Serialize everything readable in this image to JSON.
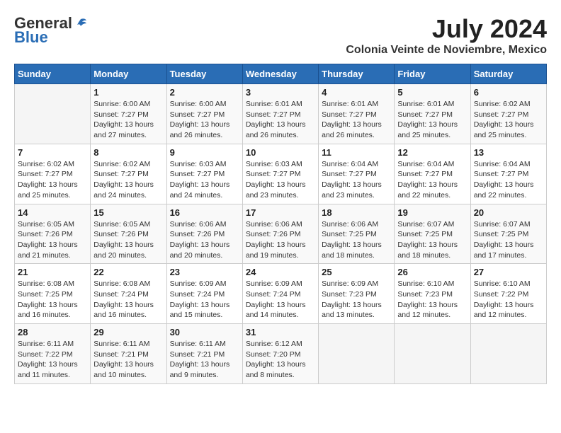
{
  "header": {
    "logo_line1": "General",
    "logo_line2": "Blue",
    "month_year": "July 2024",
    "location": "Colonia Veinte de Noviembre, Mexico"
  },
  "days_of_week": [
    "Sunday",
    "Monday",
    "Tuesday",
    "Wednesday",
    "Thursday",
    "Friday",
    "Saturday"
  ],
  "weeks": [
    [
      {
        "num": "",
        "sunrise": "",
        "sunset": "",
        "daylight": ""
      },
      {
        "num": "1",
        "sunrise": "Sunrise: 6:00 AM",
        "sunset": "Sunset: 7:27 PM",
        "daylight": "Daylight: 13 hours and 27 minutes."
      },
      {
        "num": "2",
        "sunrise": "Sunrise: 6:00 AM",
        "sunset": "Sunset: 7:27 PM",
        "daylight": "Daylight: 13 hours and 26 minutes."
      },
      {
        "num": "3",
        "sunrise": "Sunrise: 6:01 AM",
        "sunset": "Sunset: 7:27 PM",
        "daylight": "Daylight: 13 hours and 26 minutes."
      },
      {
        "num": "4",
        "sunrise": "Sunrise: 6:01 AM",
        "sunset": "Sunset: 7:27 PM",
        "daylight": "Daylight: 13 hours and 26 minutes."
      },
      {
        "num": "5",
        "sunrise": "Sunrise: 6:01 AM",
        "sunset": "Sunset: 7:27 PM",
        "daylight": "Daylight: 13 hours and 25 minutes."
      },
      {
        "num": "6",
        "sunrise": "Sunrise: 6:02 AM",
        "sunset": "Sunset: 7:27 PM",
        "daylight": "Daylight: 13 hours and 25 minutes."
      }
    ],
    [
      {
        "num": "7",
        "sunrise": "Sunrise: 6:02 AM",
        "sunset": "Sunset: 7:27 PM",
        "daylight": "Daylight: 13 hours and 25 minutes."
      },
      {
        "num": "8",
        "sunrise": "Sunrise: 6:02 AM",
        "sunset": "Sunset: 7:27 PM",
        "daylight": "Daylight: 13 hours and 24 minutes."
      },
      {
        "num": "9",
        "sunrise": "Sunrise: 6:03 AM",
        "sunset": "Sunset: 7:27 PM",
        "daylight": "Daylight: 13 hours and 24 minutes."
      },
      {
        "num": "10",
        "sunrise": "Sunrise: 6:03 AM",
        "sunset": "Sunset: 7:27 PM",
        "daylight": "Daylight: 13 hours and 23 minutes."
      },
      {
        "num": "11",
        "sunrise": "Sunrise: 6:04 AM",
        "sunset": "Sunset: 7:27 PM",
        "daylight": "Daylight: 13 hours and 23 minutes."
      },
      {
        "num": "12",
        "sunrise": "Sunrise: 6:04 AM",
        "sunset": "Sunset: 7:27 PM",
        "daylight": "Daylight: 13 hours and 22 minutes."
      },
      {
        "num": "13",
        "sunrise": "Sunrise: 6:04 AM",
        "sunset": "Sunset: 7:27 PM",
        "daylight": "Daylight: 13 hours and 22 minutes."
      }
    ],
    [
      {
        "num": "14",
        "sunrise": "Sunrise: 6:05 AM",
        "sunset": "Sunset: 7:26 PM",
        "daylight": "Daylight: 13 hours and 21 minutes."
      },
      {
        "num": "15",
        "sunrise": "Sunrise: 6:05 AM",
        "sunset": "Sunset: 7:26 PM",
        "daylight": "Daylight: 13 hours and 20 minutes."
      },
      {
        "num": "16",
        "sunrise": "Sunrise: 6:06 AM",
        "sunset": "Sunset: 7:26 PM",
        "daylight": "Daylight: 13 hours and 20 minutes."
      },
      {
        "num": "17",
        "sunrise": "Sunrise: 6:06 AM",
        "sunset": "Sunset: 7:26 PM",
        "daylight": "Daylight: 13 hours and 19 minutes."
      },
      {
        "num": "18",
        "sunrise": "Sunrise: 6:06 AM",
        "sunset": "Sunset: 7:25 PM",
        "daylight": "Daylight: 13 hours and 18 minutes."
      },
      {
        "num": "19",
        "sunrise": "Sunrise: 6:07 AM",
        "sunset": "Sunset: 7:25 PM",
        "daylight": "Daylight: 13 hours and 18 minutes."
      },
      {
        "num": "20",
        "sunrise": "Sunrise: 6:07 AM",
        "sunset": "Sunset: 7:25 PM",
        "daylight": "Daylight: 13 hours and 17 minutes."
      }
    ],
    [
      {
        "num": "21",
        "sunrise": "Sunrise: 6:08 AM",
        "sunset": "Sunset: 7:25 PM",
        "daylight": "Daylight: 13 hours and 16 minutes."
      },
      {
        "num": "22",
        "sunrise": "Sunrise: 6:08 AM",
        "sunset": "Sunset: 7:24 PM",
        "daylight": "Daylight: 13 hours and 16 minutes."
      },
      {
        "num": "23",
        "sunrise": "Sunrise: 6:09 AM",
        "sunset": "Sunset: 7:24 PM",
        "daylight": "Daylight: 13 hours and 15 minutes."
      },
      {
        "num": "24",
        "sunrise": "Sunrise: 6:09 AM",
        "sunset": "Sunset: 7:24 PM",
        "daylight": "Daylight: 13 hours and 14 minutes."
      },
      {
        "num": "25",
        "sunrise": "Sunrise: 6:09 AM",
        "sunset": "Sunset: 7:23 PM",
        "daylight": "Daylight: 13 hours and 13 minutes."
      },
      {
        "num": "26",
        "sunrise": "Sunrise: 6:10 AM",
        "sunset": "Sunset: 7:23 PM",
        "daylight": "Daylight: 13 hours and 12 minutes."
      },
      {
        "num": "27",
        "sunrise": "Sunrise: 6:10 AM",
        "sunset": "Sunset: 7:22 PM",
        "daylight": "Daylight: 13 hours and 12 minutes."
      }
    ],
    [
      {
        "num": "28",
        "sunrise": "Sunrise: 6:11 AM",
        "sunset": "Sunset: 7:22 PM",
        "daylight": "Daylight: 13 hours and 11 minutes."
      },
      {
        "num": "29",
        "sunrise": "Sunrise: 6:11 AM",
        "sunset": "Sunset: 7:21 PM",
        "daylight": "Daylight: 13 hours and 10 minutes."
      },
      {
        "num": "30",
        "sunrise": "Sunrise: 6:11 AM",
        "sunset": "Sunset: 7:21 PM",
        "daylight": "Daylight: 13 hours and 9 minutes."
      },
      {
        "num": "31",
        "sunrise": "Sunrise: 6:12 AM",
        "sunset": "Sunset: 7:20 PM",
        "daylight": "Daylight: 13 hours and 8 minutes."
      },
      {
        "num": "",
        "sunrise": "",
        "sunset": "",
        "daylight": ""
      },
      {
        "num": "",
        "sunrise": "",
        "sunset": "",
        "daylight": ""
      },
      {
        "num": "",
        "sunrise": "",
        "sunset": "",
        "daylight": ""
      }
    ]
  ]
}
